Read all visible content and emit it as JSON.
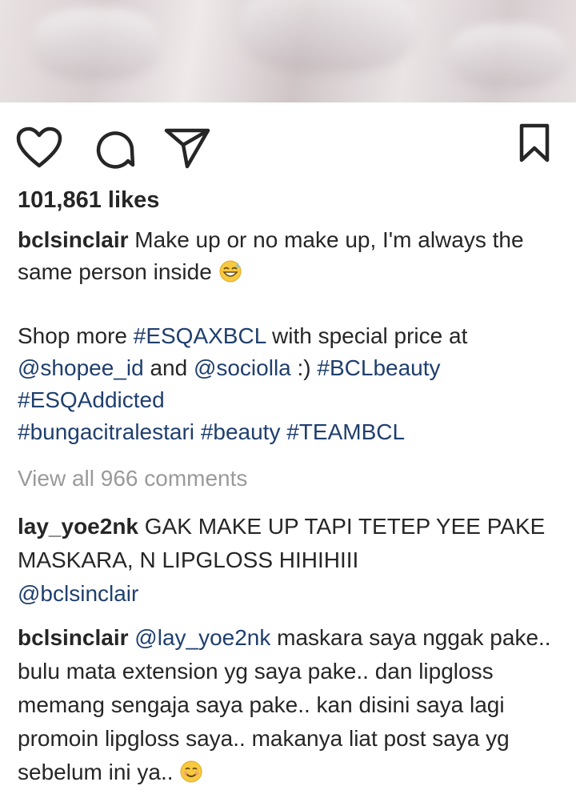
{
  "post": {
    "likes": "101,861 likes",
    "caption": {
      "username": "bclsinclair",
      "line1": "Make up or no make up, I'm always the same person inside",
      "line1_emoji": "grinning-sweat-emoji",
      "shop_prefix": "Shop more",
      "hashtag_esqaxbcl": "#ESQAXBCL",
      "shop_middle": "with special price at",
      "mention_shopee": "@shopee_id",
      "and_text": "and",
      "mention_sociolla": "@sociolla",
      "smiley_text": ":)",
      "hashtag_bclbeauty": "#BCLbeauty",
      "hashtag_esqaddicted": "#ESQAddicted",
      "hashtag_bunga": "#bungacitralestari",
      "hashtag_beauty": "#beauty",
      "hashtag_teambcl": "#TEAMBCL"
    },
    "view_all_comments": "View all 966 comments"
  },
  "actions": {
    "like_icon": "heart-icon",
    "comment_icon": "comment-icon",
    "share_icon": "send-icon",
    "save_icon": "bookmark-icon"
  },
  "comments": [
    {
      "username": "lay_yoe2nk",
      "text": "GAK MAKE UP TAPI TETEP YEE PAKE MASKARA, N LIPGLOSS HIHIHIII",
      "mention": "@bclsinclair"
    },
    {
      "username": "bclsinclair",
      "mention": "@lay_yoe2nk",
      "text": "maskara saya nggak pake.. bulu mata extension yg saya pake.. dan lipgloss memang sengaja saya pake.. kan disini saya lagi promoin lipgloss saya.. makanya liat post saya yg sebelum ini ya..",
      "emoji": "smiling-emoji"
    }
  ],
  "colors": {
    "text": "#262626",
    "link": "#1f3f6e",
    "muted": "#9a9a9a"
  }
}
